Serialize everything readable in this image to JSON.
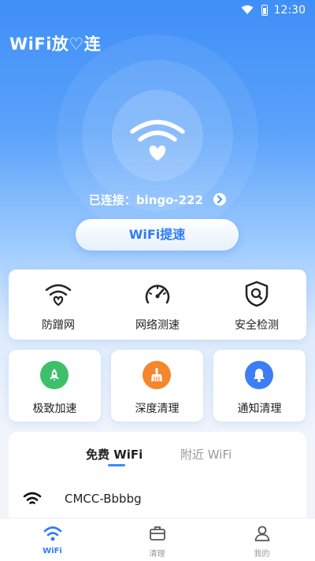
{
  "status_bar": {
    "time": "12:30"
  },
  "app": {
    "title": "WiFi放♡连"
  },
  "connection": {
    "label": "已连接：",
    "ssid": "bingo-222"
  },
  "speed_button": {
    "label": "WiFi提速"
  },
  "tools": [
    {
      "label": "防蹭网",
      "icon": "wifi-heart-icon"
    },
    {
      "label": "网络测速",
      "icon": "speedometer-icon"
    },
    {
      "label": "安全检测",
      "icon": "shield-search-icon"
    }
  ],
  "quick_cards": [
    {
      "label": "极致加速",
      "icon": "rocket-icon",
      "color": "#3ec06a"
    },
    {
      "label": "深度清理",
      "icon": "broom-icon",
      "color": "#f6862b"
    },
    {
      "label": "通知清理",
      "icon": "bell-icon",
      "color": "#3d7df6"
    }
  ],
  "wifi_tabs": {
    "free": "免费 WiFi",
    "nearby": "附近 WiFi"
  },
  "networks": [
    {
      "name": "CMCC-Bbbbg"
    }
  ],
  "bottom_nav": [
    {
      "label": "WiFi",
      "icon": "wifi-icon",
      "active": true
    },
    {
      "label": "清理",
      "icon": "briefcase-icon",
      "active": false
    },
    {
      "label": "我的",
      "icon": "profile-icon",
      "active": false
    }
  ],
  "colors": {
    "accent": "#2e7cf6",
    "background_top": "#3f8ff8"
  }
}
